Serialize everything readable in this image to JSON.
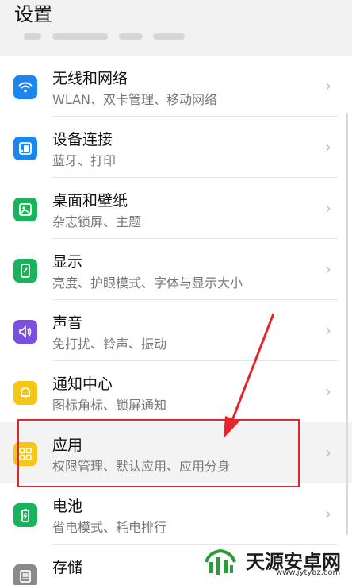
{
  "header": {
    "title": "设置"
  },
  "settings": [
    {
      "title": "无线和网络",
      "subtitle": "WLAN、双卡管理、移动网络",
      "icon": "wifi-icon",
      "color": "#1a86f0"
    },
    {
      "title": "设备连接",
      "subtitle": "蓝牙、打印",
      "icon": "device-connect-icon",
      "color": "#1a86f0"
    },
    {
      "title": "桌面和壁纸",
      "subtitle": "杂志锁屏、主题",
      "icon": "wallpaper-icon",
      "color": "#19b35c"
    },
    {
      "title": "显示",
      "subtitle": "亮度、护眼模式、字体与显示大小",
      "icon": "display-icon",
      "color": "#19b35c"
    },
    {
      "title": "声音",
      "subtitle": "免打扰、铃声、振动",
      "icon": "sound-icon",
      "color": "#7c4fe0"
    },
    {
      "title": "通知中心",
      "subtitle": "图标角标、锁屏通知",
      "icon": "bell-icon",
      "color": "#f5c518"
    },
    {
      "title": "应用",
      "subtitle": "权限管理、默认应用、应用分身",
      "icon": "apps-icon",
      "color": "#f5c518"
    },
    {
      "title": "电池",
      "subtitle": "省电模式、耗电排行",
      "icon": "battery-icon",
      "color": "#19b35c"
    },
    {
      "title": "存储",
      "subtitle": "",
      "icon": "storage-icon",
      "color": "#8a8a8a"
    }
  ],
  "watermark": {
    "name": "天源安卓网",
    "url": "www.jytyaz.com"
  },
  "annotation": {
    "color": "#e5252a",
    "highlighted_item": "应用"
  }
}
